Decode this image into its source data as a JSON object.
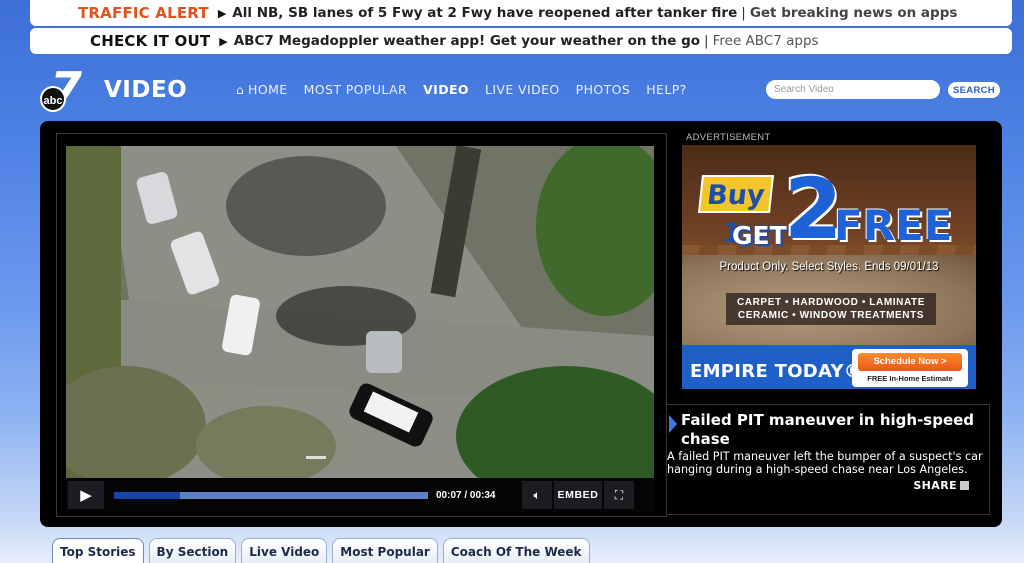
{
  "alerts": [
    {
      "tag": "TRAFFIC ALERT",
      "text": "All NB, SB lanes of 5 Fwy at 2 Fwy have reopened after tanker fire",
      "sep": "|",
      "link": "Get breaking news on apps"
    },
    {
      "tag": "CHECK IT OUT",
      "text": "ABC7 Megadoppler weather app! Get your weather on the go",
      "sep": "|",
      "link": "Free ABC7 apps"
    }
  ],
  "header": {
    "logo_number": "7",
    "logo_abc": "abc",
    "title": "VIDEO",
    "nav": [
      {
        "label": "HOME",
        "icon": "home-icon"
      },
      {
        "label": "MOST POPULAR"
      },
      {
        "label": "VIDEO",
        "active": true
      },
      {
        "label": "LIVE VIDEO"
      },
      {
        "label": "PHOTOS"
      },
      {
        "label": "HELP?"
      }
    ],
    "search_placeholder": "Search Video",
    "search_button": "SEARCH"
  },
  "player": {
    "current_time": "00:07 / 00:34",
    "progress": 0.21,
    "embed_label": "EMBED",
    "play_icon": "play-icon",
    "volume_icon": "volume-icon",
    "fullscreen_icon": "fullscreen-icon"
  },
  "ad": {
    "label": "ADVERTISEMENT",
    "buy": "Buy 1",
    "get": "GET",
    "two": "2",
    "free": "FREE",
    "fine_print": "Product Only. Select Styles. Ends 09/01/13",
    "categories_line1": "CARPET • HARDWOOD • LAMINATE",
    "categories_line2": "CERAMIC • WINDOW TREATMENTS",
    "brand": "EMPIRE TODAY®",
    "cta": "Schedule Now >",
    "cta_sub": "FREE In-Home Estimate"
  },
  "caption": {
    "title": "Failed PIT maneuver in high-speed chase",
    "description": "A failed PIT maneuver left the bumper of a suspect's car hanging during a high-speed chase near Los Angeles.",
    "share_label": "SHARE"
  },
  "tabs": [
    "Top Stories",
    "By Section",
    "Live Video",
    "Most Popular",
    "Coach Of The Week"
  ],
  "colors": {
    "alert_orange": "#e0531d",
    "accent_blue": "#1f62d8",
    "panel_black": "#000000"
  }
}
